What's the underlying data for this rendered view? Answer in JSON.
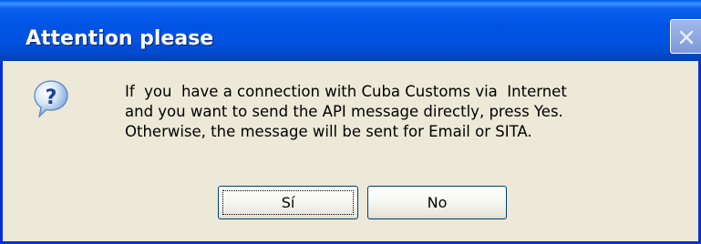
{
  "dialog": {
    "title": "Attention please",
    "icon": "question-icon",
    "message_lines": [
      "If  you  have a connection with Cuba Customs via  Internet",
      "and you want to send the API message directly, press Yes.",
      "Otherwise, the message will be sent for Email or SITA."
    ],
    "buttons": {
      "yes_label": "Sí",
      "no_label": "No"
    },
    "close_icon": "close-icon"
  },
  "colors": {
    "titlebar": "#0055e5",
    "window_face": "#ece9d8",
    "border": "#0831d9"
  }
}
